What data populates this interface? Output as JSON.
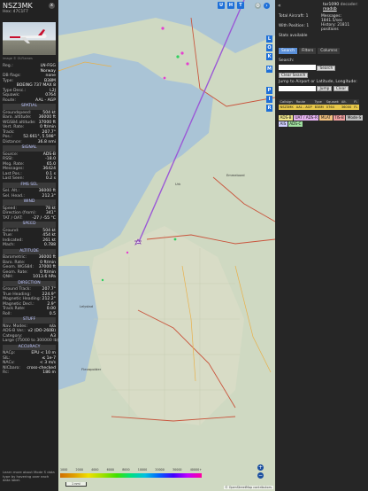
{
  "aircraft": {
    "callsign": "NSZ3MK",
    "hex_line": "Hex: 47C1F7",
    "photo_credit": "image © OLFlames",
    "close": "x"
  },
  "details": [
    [
      "Reg.:",
      "LN-FGG"
    ],
    [
      "",
      "Norway"
    ],
    [
      "DB flags:",
      "none"
    ],
    [
      "Type:",
      "B38M"
    ],
    [
      "",
      "BOEING 737 MAX 8"
    ],
    [
      "Type Desc.:",
      "L2J"
    ],
    [
      "Squawk:",
      "0764"
    ],
    [
      "Route:",
      "AAL - AGP"
    ]
  ],
  "sections": [
    {
      "title": "SPATIAL",
      "rows": [
        [
          "Groundspeed:",
          "504 kt"
        ],
        [
          "Baro. altitude:",
          "36000 ft"
        ],
        [
          "WGS84 altitude:",
          "37000 ft"
        ],
        [
          "Vert. Rate:",
          "0 ft/min"
        ],
        [
          "Track:",
          "207.7°"
        ],
        [
          "Pos.:",
          "52.661°, 5.598°"
        ],
        [
          "Distance:",
          "36.8 nmi"
        ]
      ]
    },
    {
      "title": "SIGNAL",
      "rows": [
        [
          "Source:",
          "ADS-B"
        ],
        [
          "RSSI:",
          "-18.0"
        ],
        [
          "Msg. Rate:",
          "65.0"
        ],
        [
          "Messages:",
          "36424"
        ],
        [
          "Last Pos.:",
          "0.1 s"
        ],
        [
          "Last Seen:",
          "0.2 s"
        ]
      ]
    },
    {
      "title": "FMS SEL",
      "rows": [
        [
          "Sel. Alt.:",
          "36000 ft"
        ],
        [
          "Sel. Head.:",
          "212.3°"
        ]
      ]
    },
    {
      "title": "WIND",
      "rows": [
        [
          "Speed:",
          "78 kt"
        ],
        [
          "Direction (from):",
          "341°"
        ],
        [
          "TAT / OAT:",
          "-27 / -55 °C"
        ]
      ]
    },
    {
      "title": "SPEED",
      "rows": [
        [
          "Ground:",
          "504 kt"
        ],
        [
          "True:",
          "454 kt"
        ],
        [
          "Indicated:",
          "261 kt"
        ],
        [
          "Mach:",
          "0.788"
        ]
      ]
    },
    {
      "title": "ALTITUDE",
      "rows": [
        [
          "Barometric:",
          "36000 ft"
        ],
        [
          "Baro. Rate:",
          "0 ft/min"
        ],
        [
          "Geom. WGS84:",
          "37000 ft"
        ],
        [
          "Geom. Rate:",
          "0 ft/min"
        ],
        [
          "QNH:",
          "1013.6 hPa"
        ]
      ]
    },
    {
      "title": "DIRECTION",
      "rows": [
        [
          "Ground Track:",
          "207.7°"
        ],
        [
          "True Heading:",
          "224.9°"
        ],
        [
          "Magnetic Heading:",
          "212.2°"
        ],
        [
          "Magnetic Decl.:",
          "2.9°"
        ],
        [
          "Track Rate:",
          "0.00"
        ],
        [
          "Roll:",
          "0.5"
        ]
      ]
    },
    {
      "title": "STUFF",
      "rows": [
        [
          "Nav. Modes:",
          "n/a"
        ],
        [
          "ADS-B Ver.:",
          "v2 (DO-260B)"
        ],
        [
          "Category:",
          "A3"
        ],
        [
          "Large (75000 to 300000 lb)",
          ""
        ]
      ]
    },
    {
      "title": "ACCURACY",
      "rows": [
        [
          "NACp:",
          "EPU < 10 m"
        ],
        [
          "SIL:",
          "≤ 1e-7"
        ],
        [
          "NACv:",
          "< 3 m/s"
        ],
        [
          "NICbaro:",
          "cross-checked"
        ],
        [
          "Rc:",
          "186 m"
        ]
      ]
    }
  ],
  "note": "Learn more about Mode S data type by hovering over each data label.",
  "map": {
    "top_buttons": [
      "U",
      "H",
      "T"
    ],
    "side_buttons": [
      "L",
      "O",
      "K",
      "M",
      "P",
      "I",
      "R"
    ],
    "zoom_in": "+",
    "zoom_out": "−",
    "scale": "1 nmi",
    "osm": "© OpenStreetMap contributors.",
    "legend": [
      "1000",
      "2000",
      "4000",
      "6000",
      "8000",
      "10000",
      "20000",
      "30000",
      "40000+"
    ],
    "places": [
      "Lelystad",
      "Flevopolder",
      "Urk",
      "Emmeloord",
      "Enkhuizen",
      "Lemmer"
    ]
  },
  "right": {
    "title": "tar1090",
    "decoder": "decoder:",
    "decoder_link": "readsb",
    "total_label": "Total Aircraft:",
    "total_value": "1",
    "pos_label": "With Position:",
    "pos_value": "1",
    "msgs_label": "Messages:",
    "msgs_value": "1841.5/sec",
    "hist_label": "History:",
    "hist_value": "21811 positions",
    "stats_link": "Stats available",
    "tabs": [
      "Search",
      "Filters",
      "Columns"
    ],
    "search_label": "Search:",
    "search_btn": "Search",
    "clear_btn": "Clear Search",
    "jump_label": "Jump to Airport or Latitude, Longitude:",
    "jump_btn": "Jump",
    "jump_clear": "Clear",
    "table_headers": [
      "Callsign",
      "Route",
      "Type",
      "Squawk",
      "Alt.",
      "Fl."
    ],
    "table_row": [
      "NSZ3MK",
      "AAL - AGP",
      "B38M",
      "0764",
      "36000",
      "FL"
    ],
    "chips": [
      {
        "label": "ADS-B",
        "color": "#f0e68c"
      },
      {
        "label": "UAT / ADS-R",
        "color": "#e6b3f0"
      },
      {
        "label": "MLAT",
        "color": "#f0c080"
      },
      {
        "label": "TIS-B",
        "color": "#f0a0a0"
      },
      {
        "label": "Mode-S",
        "color": "#c0c0c0"
      },
      {
        "label": "AIS",
        "color": "#d0d0ff"
      },
      {
        "label": "ADS-C",
        "color": "#a0e0a0"
      }
    ]
  }
}
